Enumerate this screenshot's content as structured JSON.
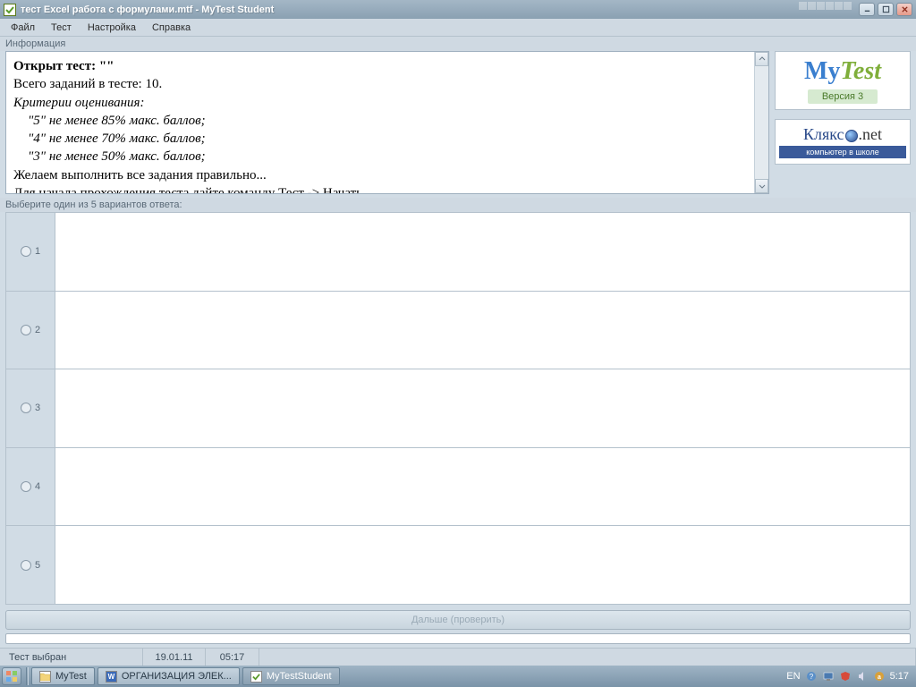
{
  "titlebar": {
    "title": "тест Excel работа с формулами.mtf - MyTest Student"
  },
  "menu": {
    "file": "Файл",
    "test": "Тест",
    "settings": "Настройка",
    "help": "Справка"
  },
  "info_panel": {
    "label": "Информация",
    "line_opened": "Открыт тест: \"\"",
    "line_total": "Всего заданий в тесте: 10.",
    "line_criteria": "Критерии оценивания:",
    "grade5": "\"5\" не менее 85% макс. баллов;",
    "grade4": "\"4\" не менее 70% макс. баллов;",
    "grade3": "\"3\" не менее 50% макс. баллов;",
    "wish": "Желаем выполнить все задания правильно...",
    "start_hint": "Для начала прохождения теста дайте команду Тест -> Начать..."
  },
  "logo": {
    "my": "My",
    "test": "Test",
    "version": "Версия 3",
    "klyakso": "Клякс",
    "klyakso_net": ".net",
    "klyakso_sub": "компьютер в школе"
  },
  "answers": {
    "hint": "Выберите один из 5 вариантов ответа:",
    "options": [
      "1",
      "2",
      "3",
      "4",
      "5"
    ]
  },
  "buttons": {
    "next": "Дальше (проверить)"
  },
  "status": {
    "test_state": "Тест выбран",
    "date": "19.01.11",
    "time": "05:17"
  },
  "taskbar": {
    "items": [
      {
        "label": "MyTest",
        "icon": "folder"
      },
      {
        "label": "ОРГАНИЗАЦИЯ ЭЛЕК...",
        "icon": "word"
      },
      {
        "label": "MyTestStudent",
        "icon": "app"
      }
    ],
    "lang": "EN",
    "clock": "5:17"
  }
}
